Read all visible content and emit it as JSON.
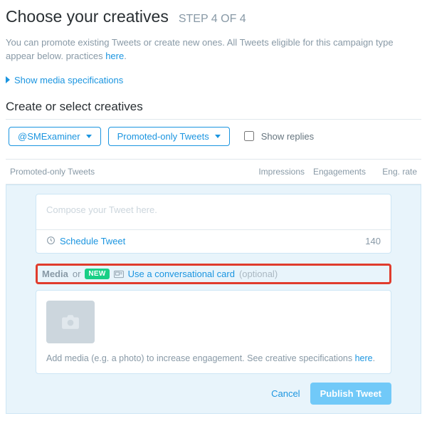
{
  "header": {
    "title": "Choose your creatives",
    "step_label": "STEP 4 OF 4"
  },
  "intro": {
    "text_prefix": "You can promote existing Tweets or create new ones. All Tweets eligible for this campaign type appear below. practices ",
    "link_word": "here",
    "text_suffix": "."
  },
  "media_spec_link": "Show media specifications",
  "section_title": "Create or select creatives",
  "filters": {
    "account_handle": "@SMExaminer",
    "tweet_type_label": "Promoted-only Tweets",
    "show_replies_label": "Show replies"
  },
  "table": {
    "col_main": "Promoted-only Tweets",
    "col_impressions": "Impressions",
    "col_engagements": "Engagements",
    "col_eng_rate": "Eng. rate"
  },
  "compose": {
    "placeholder": "Compose your Tweet here.",
    "schedule_label": "Schedule Tweet",
    "char_count": "140"
  },
  "media_row": {
    "label": "Media",
    "or": "or",
    "new_badge": "NEW",
    "conv_link": "Use a conversational card",
    "optional": "(optional)"
  },
  "media_box": {
    "hint_prefix": "Add media (e.g. a photo) to increase engagement. See creative specifications ",
    "hint_link": "here",
    "hint_suffix": "."
  },
  "actions": {
    "cancel": "Cancel",
    "publish": "Publish Tweet"
  }
}
